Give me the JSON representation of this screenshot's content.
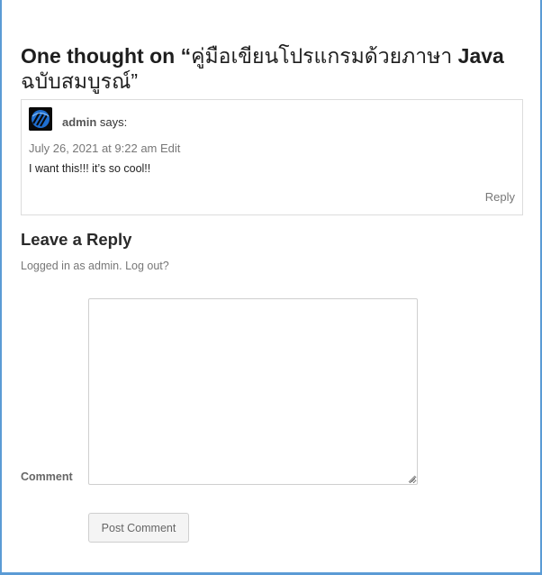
{
  "comments_section": {
    "title_prefix": "One thought on “",
    "title_thai": "คู่มือเขียนโปรแกรมด้วยภาษา",
    "title_java": " Java",
    "title_suffix_thai": "ฉบับสมบูรณ์”"
  },
  "comment": {
    "author": "admin",
    "says": " says:",
    "date": "July 26, 2021 at 9:22 am",
    "edit_label": "Edit",
    "text": "I want this!!! it’s so cool!!",
    "reply_label": "Reply"
  },
  "reply_form": {
    "title": "Leave a Reply",
    "logged_in_text": "Logged in as admin.",
    "logout_label": "Log out?",
    "comment_label": "Comment",
    "comment_value": "",
    "submit_label": "Post Comment"
  },
  "colors": {
    "frame": "#5b9bd5",
    "avatar_bg": "#0a0a0a",
    "avatar_accent": "#2d8cf0"
  },
  "icons": {
    "avatar": "avatar-logo-icon",
    "resize": "resize-grip-icon"
  }
}
